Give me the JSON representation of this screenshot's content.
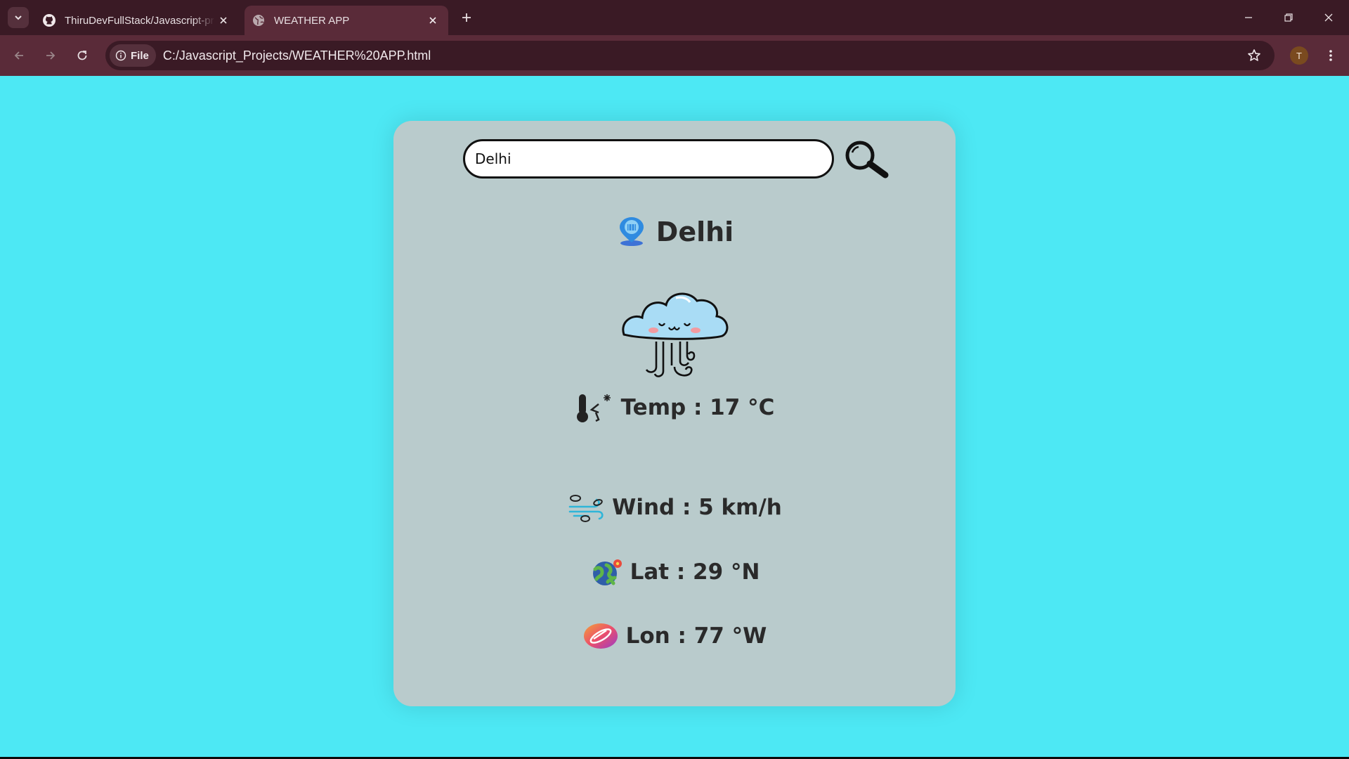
{
  "browser": {
    "tabs": [
      {
        "title": "ThiruDevFullStack/Javascript-pr",
        "icon": "github-icon",
        "active": false
      },
      {
        "title": "WEATHER APP",
        "icon": "globe-icon",
        "active": true
      }
    ],
    "address": {
      "chip_label": "File",
      "url": "C:/Javascript_Projects/WEATHER%20APP.html"
    },
    "profile_initial": "T"
  },
  "app": {
    "search": {
      "value": "Delhi",
      "placeholder": ""
    },
    "city": "Delhi",
    "weather_icon": "windy-cloud-icon",
    "temp": "Temp : 17 °C",
    "wind": "Wind : 5 km/h",
    "lat": "Lat : 29 °N",
    "lon": "Lon : 77 °W"
  },
  "colors": {
    "page_bg": "#4de8f4",
    "card_bg": "#b9cbcc",
    "chrome_tabbar": "#3a1a25",
    "chrome_toolbar": "#5a2b39"
  }
}
